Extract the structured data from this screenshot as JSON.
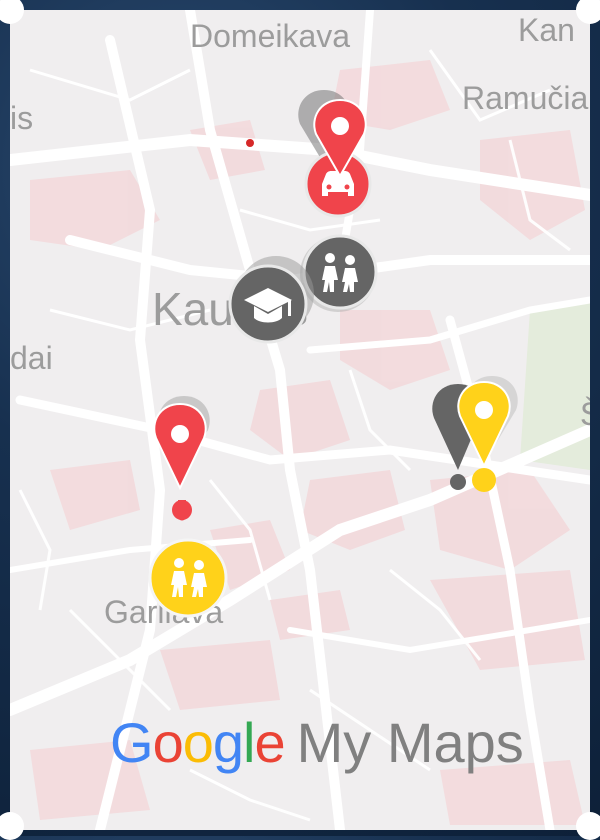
{
  "map": {
    "places": [
      {
        "name": "Domeikava"
      },
      {
        "name": "Kan"
      },
      {
        "name": "Ramučia"
      },
      {
        "name": "is"
      },
      {
        "name": "Kaunas"
      },
      {
        "name": "dai"
      },
      {
        "name": "Garliava"
      },
      {
        "name": "Š"
      }
    ],
    "colors": {
      "red_marker": "#f0444b",
      "dark_marker": "#656565",
      "yellow_marker": "#ffd21a",
      "road": "#ffffff",
      "urban": "#f3d9dc",
      "land": "#f0eeef"
    },
    "markers": [
      {
        "color": "red",
        "icon": "car-icon"
      },
      {
        "color": "dark",
        "icon": "school-children-icon"
      },
      {
        "color": "dark",
        "icon": "graduation-cap-icon"
      },
      {
        "color": "red",
        "icon": "pin-icon"
      },
      {
        "color": "yellow",
        "icon": "school-children-icon"
      },
      {
        "color": "yellow",
        "icon": "pin-icon"
      }
    ]
  },
  "branding": {
    "letters": [
      "G",
      "o",
      "o",
      "g",
      "l",
      "e"
    ],
    "product": "My Maps"
  }
}
